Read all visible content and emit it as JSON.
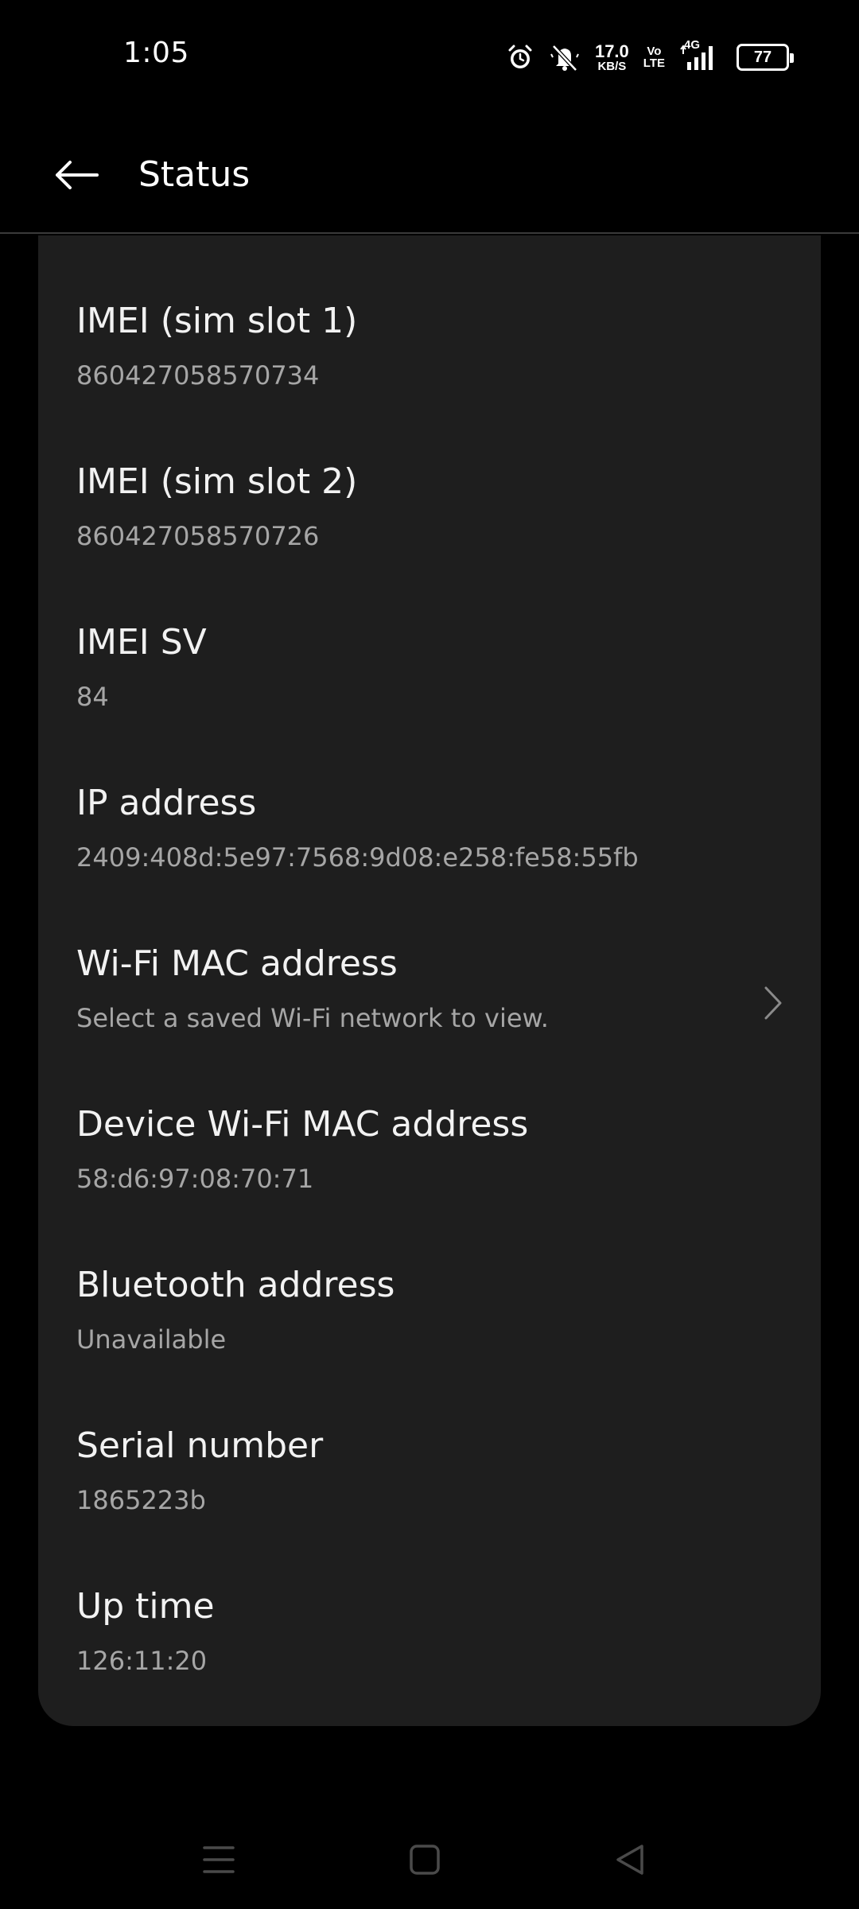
{
  "status_bar": {
    "time": "1:05",
    "net_speed_value": "17.0",
    "net_speed_unit": "KB/S",
    "volte_top": "Vo",
    "volte_bottom": "LTE",
    "network_type": "4G",
    "battery_level": "77",
    "icons": [
      "alarm-icon",
      "mute-icon",
      "signal-icon",
      "battery-icon"
    ]
  },
  "toolbar": {
    "title": "Status",
    "back_icon": "arrow-left-icon"
  },
  "items": [
    {
      "title": "IMEI (sim slot 1)",
      "value": "860427058570734"
    },
    {
      "title": "IMEI (sim slot 2)",
      "value": "860427058570726"
    },
    {
      "title": "IMEI SV",
      "value": "84"
    },
    {
      "title": "IP address",
      "value": "2409:408d:5e97:7568:9d08:e258:fe58:55fb"
    },
    {
      "title": "Wi-Fi MAC address",
      "value": "Select a saved Wi-Fi network to view.",
      "has_chevron": true
    },
    {
      "title": "Device Wi-Fi MAC address",
      "value": "58:d6:97:08:70:71"
    },
    {
      "title": "Bluetooth address",
      "value": "Unavailable"
    },
    {
      "title": "Serial number",
      "value": "1865223b"
    },
    {
      "title": "Up time",
      "value": "126:11:20"
    }
  ],
  "nav_bar": {
    "icons": [
      "menu-icon",
      "home-icon",
      "back-triangle-icon"
    ]
  },
  "colors": {
    "background": "#000000",
    "card": "#1e1e1e",
    "title_text": "#f2f2f2",
    "subtitle_text": "#a6a6a6",
    "divider": "#3a3a3a"
  }
}
